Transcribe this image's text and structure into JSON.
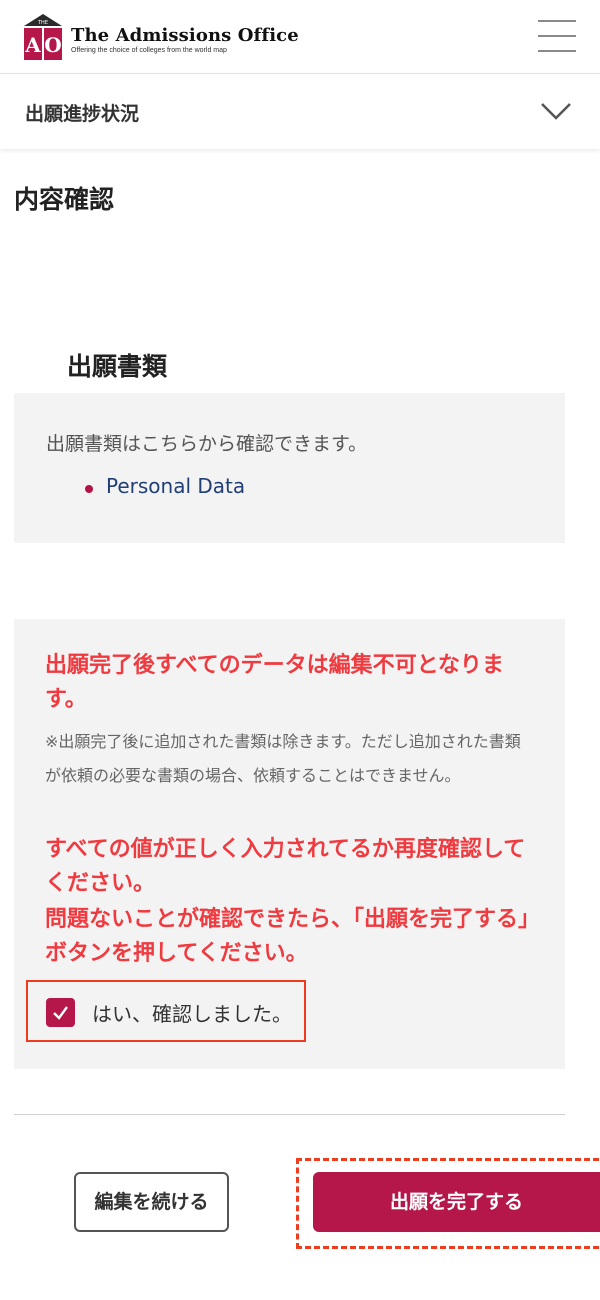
{
  "header": {
    "logo_top_text": "THE",
    "logo_letters": "AO",
    "title": "The Admissions Office",
    "tagline": "Offering the choice of colleges from the world map",
    "menu_icon": "hamburger-icon"
  },
  "progress": {
    "label": "出願進捗状況",
    "icon": "chevron-down-icon"
  },
  "page": {
    "title": "内容確認",
    "section_heading": "出願書類"
  },
  "documents": {
    "description": "出願書類はこちらから確認できます。",
    "items": [
      "Personal Data"
    ]
  },
  "notice": {
    "line1": "出願完了後すべてのデータは編集不可となります。",
    "note": "※出願完了後に追加された書類は除きます。ただし追加された書類が依頼の必要な書類の場合、依頼することはできません。",
    "line2": "すべての値が正しく入力されてるか再度確認してください。",
    "line3": "問題ないことが確認できたら、「出願を完了する」ボタンを押してください。",
    "confirm_label": "はい、確認しました。",
    "confirm_checked": true
  },
  "actions": {
    "edit_label": "編集を続ける",
    "complete_label": "出願を完了する"
  },
  "colors": {
    "brand": "#b5174a",
    "warning_text": "#ef3b40",
    "highlight_border": "#ef3b1e",
    "link": "#1f3f75"
  }
}
